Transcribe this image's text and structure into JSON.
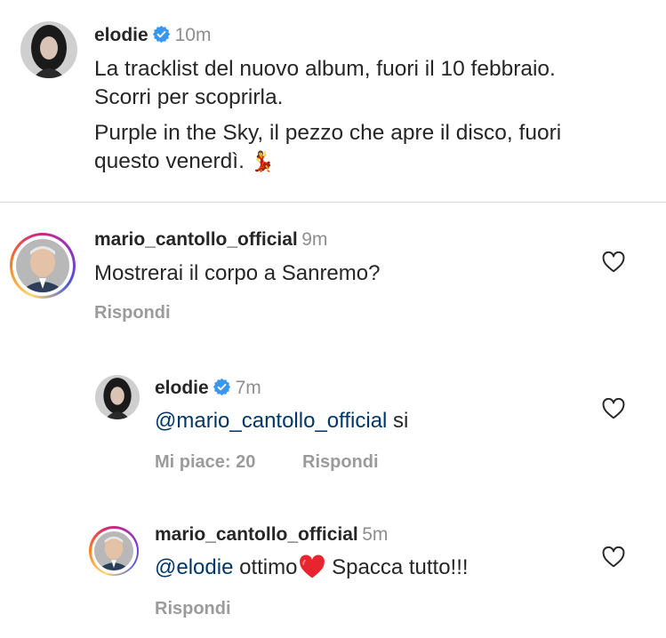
{
  "post": {
    "author": "elodie",
    "time": "10m",
    "caption_line1": "La tracklist del nuovo album, fuori il 10 febbraio.",
    "caption_line2": "Scorri per scoprirla.",
    "caption_line3": "Purple in the Sky, il pezzo che apre il disco, fuori",
    "caption_line4": "questo venerdì.",
    "caption_emoji": "💃"
  },
  "comments": [
    {
      "author": "mario_cantollo_official",
      "time": "9m",
      "text": "Mostrerai il corpo a Sanremo?",
      "reply_label": "Rispondi"
    },
    {
      "author": "elodie",
      "time": "7m",
      "mention": "@mario_cantollo_official",
      "text": " si",
      "likes_label": "Mi piace: 20",
      "reply_label": "Rispondi"
    },
    {
      "author": "mario_cantollo_official",
      "time": "5m",
      "mention": "@elodie",
      "text_before": " ottimo",
      "emoji": "❤️",
      "text_after": " Spacca tutto!!!",
      "reply_label": "Rispondi"
    }
  ],
  "colors": {
    "verified": "#3897f0",
    "mention": "#00376b",
    "secondary": "#8e8e8e"
  }
}
